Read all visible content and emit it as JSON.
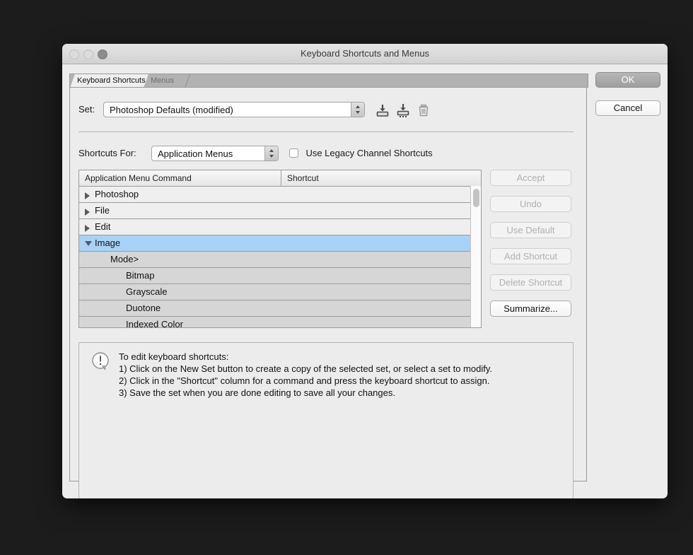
{
  "window": {
    "title": "Keyboard Shortcuts and Menus",
    "traffic": {
      "close": "close-button",
      "minimize": "minimize-button",
      "zoom": "zoom-button"
    }
  },
  "tabs": [
    {
      "label": "Keyboard Shortcuts",
      "active": true
    },
    {
      "label": "Menus",
      "active": false
    }
  ],
  "set_row": {
    "label": "Set:",
    "value": "Photoshop Defaults (modified)",
    "icons": {
      "save": "save-set-icon",
      "save_as": "save-set-as-icon",
      "delete": "delete-set-icon"
    }
  },
  "shortcuts_for_row": {
    "label": "Shortcuts For:",
    "value": "Application Menus",
    "legacy_checkbox": {
      "label": "Use Legacy Channel Shortcuts",
      "checked": false
    }
  },
  "table": {
    "columns": [
      "Application Menu Command",
      "Shortcut"
    ],
    "rows": [
      {
        "label": "Photoshop",
        "shortcut": "",
        "indent": 0,
        "disclosure": "right",
        "shade": "light",
        "selected": false
      },
      {
        "label": "File",
        "shortcut": "",
        "indent": 0,
        "disclosure": "right",
        "shade": "light",
        "selected": false
      },
      {
        "label": "Edit",
        "shortcut": "",
        "indent": 0,
        "disclosure": "right",
        "shade": "light",
        "selected": false
      },
      {
        "label": "Image",
        "shortcut": "",
        "indent": 0,
        "disclosure": "down",
        "shade": "light",
        "selected": true
      },
      {
        "label": "Mode>",
        "shortcut": "",
        "indent": 1,
        "disclosure": "none",
        "shade": "dark",
        "selected": false
      },
      {
        "label": "Bitmap",
        "shortcut": "",
        "indent": 2,
        "disclosure": "none",
        "shade": "dark",
        "selected": false
      },
      {
        "label": "Grayscale",
        "shortcut": "",
        "indent": 2,
        "disclosure": "none",
        "shade": "dark",
        "selected": false
      },
      {
        "label": "Duotone",
        "shortcut": "",
        "indent": 2,
        "disclosure": "none",
        "shade": "dark",
        "selected": false
      },
      {
        "label": "Indexed Color",
        "shortcut": "",
        "indent": 2,
        "disclosure": "none",
        "shade": "dark",
        "selected": false
      }
    ]
  },
  "side_buttons": [
    {
      "label": "Accept",
      "enabled": false
    },
    {
      "label": "Undo",
      "enabled": false
    },
    {
      "label": "Use Default",
      "enabled": false
    },
    {
      "label": "Add Shortcut",
      "enabled": false
    },
    {
      "label": "Delete Shortcut",
      "enabled": false
    },
    {
      "label": "Summarize...",
      "enabled": true
    }
  ],
  "help": {
    "icon": "alert-speech-bubble-icon",
    "lines": [
      "To edit keyboard shortcuts:",
      "1) Click on the New Set button to create a copy of the selected set, or select a set to modify.",
      "2) Click in the \"Shortcut\" column for a command and press the keyboard shortcut to assign.",
      "3) Save the set when you are done editing to save all your changes."
    ]
  },
  "dialog_buttons": {
    "ok": "OK",
    "cancel": "Cancel"
  },
  "colors": {
    "selection": "#a8d2f7",
    "dialog_background": "#ececec",
    "row_light": "#efefef",
    "row_dark": "#d6d6d6",
    "desktop": "#1c1c1c"
  }
}
